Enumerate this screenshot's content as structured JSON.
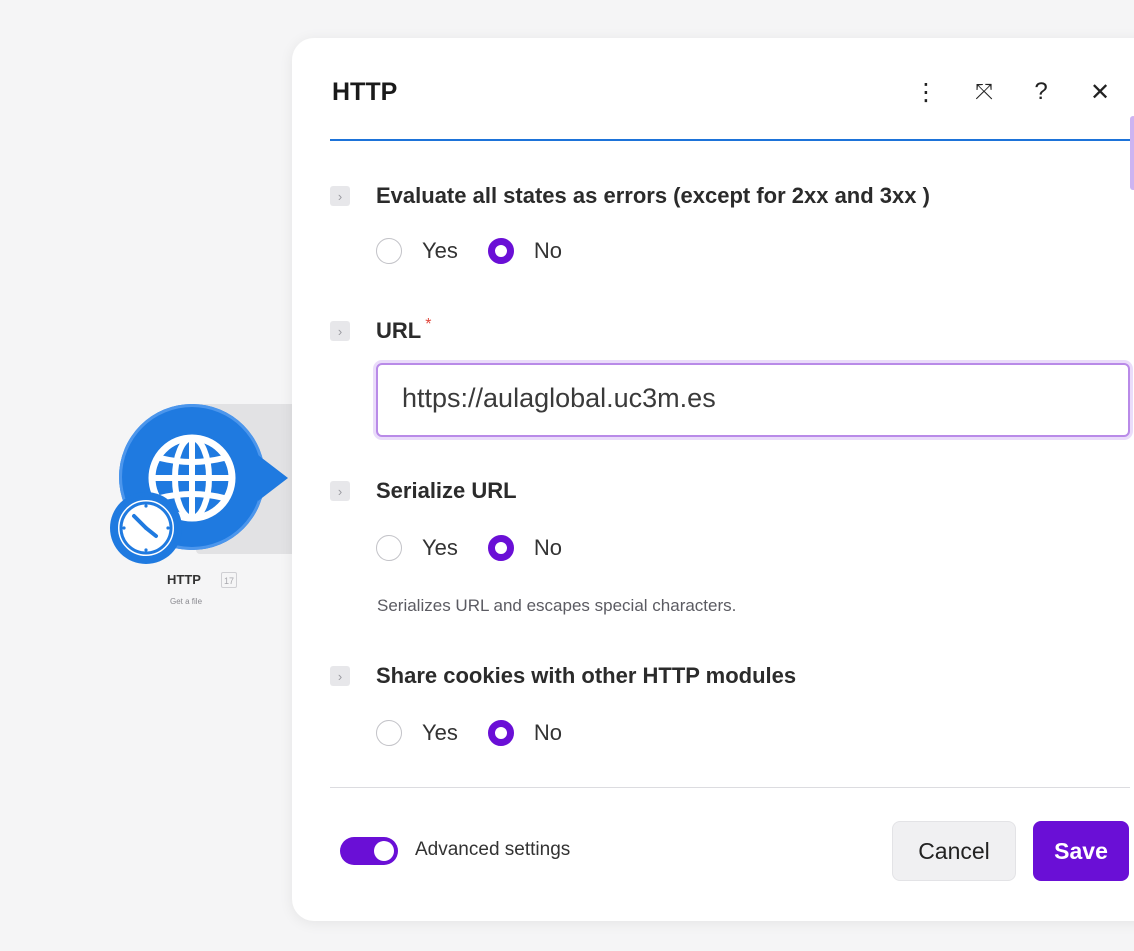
{
  "node": {
    "title": "HTTP",
    "badge": "17",
    "subtitle": "Get a file",
    "icon": "globe-icon",
    "badge_icon": "clock-icon",
    "color": "#1f7ae0"
  },
  "dialog": {
    "title": "HTTP",
    "header_icons": [
      "more-vertical-icon",
      "maximize-icon",
      "help-icon",
      "close-icon"
    ],
    "menu_glyph": "⋮",
    "maximize_glyph": "⤧",
    "help_glyph": "?",
    "close_glyph": "✕"
  },
  "fields": {
    "evaluate_errors": {
      "label": "Evaluate all states as errors (except for 2xx and 3xx )",
      "yes_label": "Yes",
      "no_label": "No",
      "selected": "No"
    },
    "url": {
      "label": "URL",
      "required_mark": "*",
      "value": "https://aulaglobal.uc3m.es"
    },
    "serialize_url": {
      "label": "Serialize URL",
      "yes_label": "Yes",
      "no_label": "No",
      "selected": "No",
      "help": "Serializes URL and escapes special characters."
    },
    "share_cookies": {
      "label": "Share cookies with other HTTP modules",
      "yes_label": "Yes",
      "no_label": "No",
      "selected": "No"
    }
  },
  "footer": {
    "advanced_label": "Advanced settings",
    "advanced_enabled": true,
    "cancel_label": "Cancel",
    "save_label": "Save"
  },
  "colors": {
    "accent": "#6a0fd6",
    "rule": "#1d73d9",
    "required": "#e0453a"
  },
  "chevron_glyph": "›"
}
